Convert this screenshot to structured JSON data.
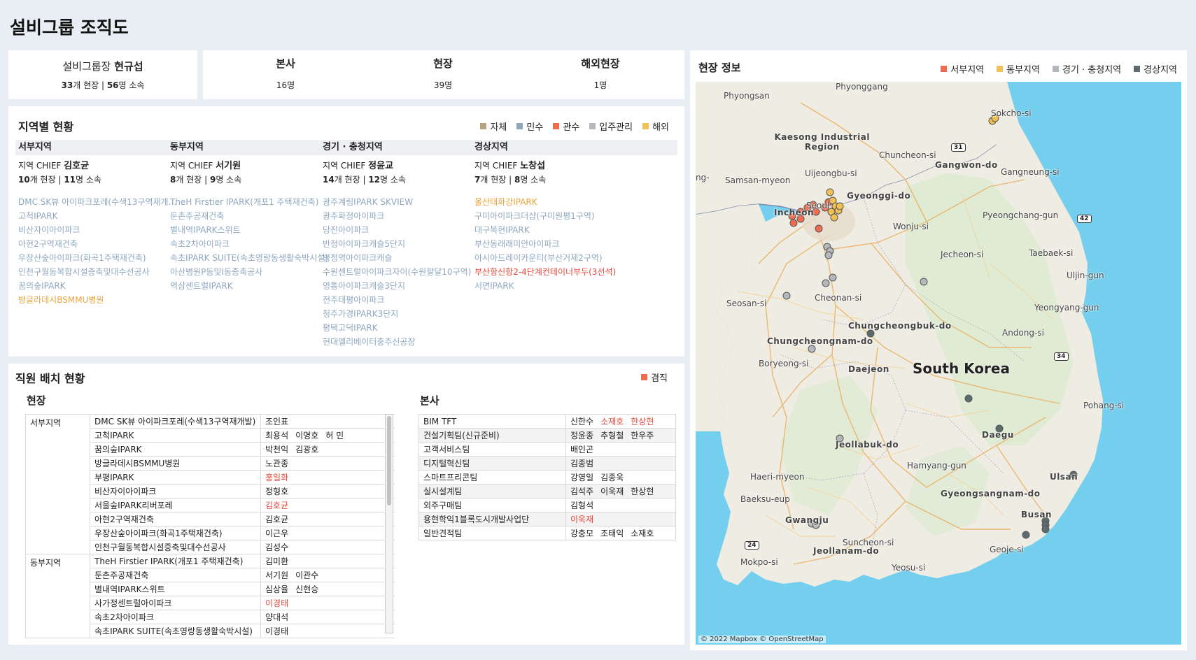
{
  "title": "설비그룹 조직도",
  "leader": {
    "role": "설비그룹장",
    "name": "현규섭",
    "sites": "33",
    "sites_suffix": "개 현장 | ",
    "members": "56",
    "members_suffix": "명 소속"
  },
  "stats": [
    {
      "label": "본사",
      "value": "16명"
    },
    {
      "label": "현장",
      "value": "39명"
    },
    {
      "label": "해외현장",
      "value": "1명"
    }
  ],
  "regional": {
    "title": "지역별 현황",
    "legend": [
      {
        "label": "자체",
        "color": "#b9a27f"
      },
      {
        "label": "민수",
        "color": "#8fa7b8"
      },
      {
        "label": "관수",
        "color": "#f26b50"
      },
      {
        "label": "입주관리",
        "color": "#b4b8bd"
      },
      {
        "label": "해외",
        "color": "#f0c255"
      }
    ],
    "regions": [
      {
        "name": "서부지역",
        "chief_prefix": "지역 CHIEF",
        "chief": "김호균",
        "sites": "10",
        "members": "11",
        "sites_suffix": "개 현장 | ",
        "members_suffix": "명 소속",
        "list": [
          {
            "name": "DMC SK뷰 아이파크포레(수색13구역재개발)",
            "tone": "blue"
          },
          {
            "name": "고척IPARK",
            "tone": "blue"
          },
          {
            "name": "비산자이아이파크",
            "tone": "blue"
          },
          {
            "name": "아현2구역재건축",
            "tone": "blue"
          },
          {
            "name": "우장산숲아이파크(화곡1주택재건축)",
            "tone": "blue"
          },
          {
            "name": "인천구월동복합시설증축및대수선공사",
            "tone": "blue"
          },
          {
            "name": "꿈의숲IPARK",
            "tone": "blue"
          },
          {
            "name": "방글라데시BSMMU병원",
            "tone": "orange"
          }
        ]
      },
      {
        "name": "동부지역",
        "chief_prefix": "지역 CHIEF",
        "chief": "서기원",
        "sites": "8",
        "members": "9",
        "sites_suffix": "개 현장 | ",
        "members_suffix": "명 소속",
        "list": [
          {
            "name": "TheH Firstier IPARK(개포1 주택재건축)",
            "tone": "blue"
          },
          {
            "name": "둔촌주공재건축",
            "tone": "blue"
          },
          {
            "name": "별내역IPARK스위트",
            "tone": "blue"
          },
          {
            "name": "속초2차아이파크",
            "tone": "blue"
          },
          {
            "name": "속초IPARK SUITE(속초영랑동생활숙박시설)",
            "tone": "blue"
          },
          {
            "name": "아산병원P동및I동증축공사",
            "tone": "blue"
          },
          {
            "name": "역삼센트럴IPARK",
            "tone": "blue"
          }
        ]
      },
      {
        "name": "경기 · 충청지역",
        "chief_prefix": "지역 CHIEF",
        "chief": "정윤교",
        "sites": "14",
        "members": "12",
        "sites_suffix": "개 현장 | ",
        "members_suffix": "명 소속",
        "list": [
          {
            "name": "광주계림IPARK SKVIEW",
            "tone": "blue"
          },
          {
            "name": "광주화정아이파크",
            "tone": "blue"
          },
          {
            "name": "당진아이파크",
            "tone": "blue"
          },
          {
            "name": "반정아이파크캐슬5단지",
            "tone": "blue"
          },
          {
            "name": "병점역아이파크캐슬",
            "tone": "blue"
          },
          {
            "name": "수원센트럴아이파크자이(수원팔달10구역)",
            "tone": "blue"
          },
          {
            "name": "영통아이파크캐슬3단지",
            "tone": "blue"
          },
          {
            "name": "전주태평아이파크",
            "tone": "blue"
          },
          {
            "name": "청주가경IPARK3단지",
            "tone": "blue"
          },
          {
            "name": "평택고덕IPARK",
            "tone": "blue"
          },
          {
            "name": "현대엘리베이터충주신공장",
            "tone": "blue"
          }
        ]
      },
      {
        "name": "경상지역",
        "chief_prefix": "지역 CHIEF",
        "chief": "노창섭",
        "sites": "7",
        "members": "8",
        "sites_suffix": "개 현장 | ",
        "members_suffix": "명 소속",
        "list": [
          {
            "name": "울산태화강IPARK",
            "tone": "orange"
          },
          {
            "name": "구미아이파크더샵(구미원평1구역)",
            "tone": "blue"
          },
          {
            "name": "대구복현IPARK",
            "tone": "blue"
          },
          {
            "name": "부산동래래미안아이파크",
            "tone": "blue"
          },
          {
            "name": "아시아드레이카운티(부산거제2구역)",
            "tone": "blue"
          },
          {
            "name": "부산항신항2-4단계컨테이너부두(3선석)",
            "tone": "red"
          },
          {
            "name": "서면IPARK",
            "tone": "blue"
          }
        ]
      }
    ]
  },
  "staffing": {
    "title": "직원 배치 현황",
    "legend_label": "겸직",
    "legend_color": "#f26b50",
    "site_title": "현장",
    "hq_title": "본사",
    "site_rows": [
      {
        "region": "서부지역",
        "site": "DMC SK뷰 아이파크포레(수색13구역재개발)",
        "names": [
          {
            "n": "조인표"
          }
        ]
      },
      {
        "region": "",
        "site": "고척IPARK",
        "names": [
          {
            "n": "최용석"
          },
          {
            "n": "이명호"
          },
          {
            "n": "허 민"
          }
        ]
      },
      {
        "region": "",
        "site": "꿈의숲IPARK",
        "names": [
          {
            "n": "박천익"
          },
          {
            "n": "김광호"
          }
        ]
      },
      {
        "region": "",
        "site": "방글라데시BSMMU병원",
        "names": [
          {
            "n": "노관종"
          }
        ]
      },
      {
        "region": "",
        "site": "부평IPARK",
        "names": [
          {
            "n": "홍일화",
            "red": true
          }
        ]
      },
      {
        "region": "",
        "site": "비산자이아이파크",
        "names": [
          {
            "n": "정형호"
          }
        ]
      },
      {
        "region": "",
        "site": "서울숲IPARK리버포레",
        "names": [
          {
            "n": "김호균",
            "red": true
          }
        ]
      },
      {
        "region": "",
        "site": "아현2구역재건축",
        "names": [
          {
            "n": "김호균"
          }
        ]
      },
      {
        "region": "",
        "site": "우장산숲아이파크(화곡1주택재건축)",
        "names": [
          {
            "n": "이근우"
          }
        ]
      },
      {
        "region": "",
        "site": "인천구월동복합시설증축및대수선공사",
        "names": [
          {
            "n": "김성수"
          }
        ]
      },
      {
        "region": "동부지역",
        "site": "TheH Firstier IPARK(개포1 주택재건축)",
        "names": [
          {
            "n": "김미환"
          }
        ]
      },
      {
        "region": "",
        "site": "둔촌주공재건축",
        "names": [
          {
            "n": "서기원"
          },
          {
            "n": "이관수"
          }
        ]
      },
      {
        "region": "",
        "site": "별내역IPARK스위트",
        "names": [
          {
            "n": "심상율"
          },
          {
            "n": "신현승"
          }
        ]
      },
      {
        "region": "",
        "site": "사가정센트럴아이파크",
        "names": [
          {
            "n": "이경태",
            "red": true
          }
        ]
      },
      {
        "region": "",
        "site": "속초2차아이파크",
        "names": [
          {
            "n": "양대석"
          }
        ]
      },
      {
        "region": "",
        "site": "속초IPARK SUITE(속초영랑동생활숙박시설)",
        "names": [
          {
            "n": "이경태"
          }
        ]
      }
    ],
    "hq_rows": [
      {
        "team": "BIM TFT",
        "names": [
          {
            "n": "신한수"
          },
          {
            "n": "소재호",
            "red": true
          },
          {
            "n": "한상현",
            "red": true
          }
        ]
      },
      {
        "team": "건설기획팀(신규준비)",
        "names": [
          {
            "n": "정윤종"
          },
          {
            "n": "추형철"
          },
          {
            "n": "한우주"
          }
        ]
      },
      {
        "team": "고객서비스팀",
        "names": [
          {
            "n": "배인곤"
          }
        ]
      },
      {
        "team": "디지털혁신팀",
        "names": [
          {
            "n": "김종범"
          }
        ]
      },
      {
        "team": "스마트프리콘팀",
        "names": [
          {
            "n": "강영일"
          },
          {
            "n": "김종욱"
          }
        ]
      },
      {
        "team": "실시설계팀",
        "names": [
          {
            "n": "김석주"
          },
          {
            "n": "이욱재"
          },
          {
            "n": "한상현"
          }
        ]
      },
      {
        "team": "외주구매팀",
        "names": [
          {
            "n": "김형석"
          }
        ]
      },
      {
        "team": "용현학익1블록도시개발사업단",
        "names": [
          {
            "n": "이욱재",
            "red": true
          }
        ]
      },
      {
        "team": "일반견적팀",
        "names": [
          {
            "n": "강충모"
          },
          {
            "n": "조태익"
          },
          {
            "n": "소재호"
          }
        ]
      }
    ]
  },
  "map": {
    "title": "현장 정보",
    "legend": [
      {
        "label": "서부지역",
        "color": "#f26b50"
      },
      {
        "label": "동부지역",
        "color": "#f0c255"
      },
      {
        "label": "경기 · 충청지역",
        "color": "#b4b8bd"
      },
      {
        "label": "경상지역",
        "color": "#5b6b6e"
      }
    ],
    "country": "South Korea",
    "attribution": "© 2022 Mapbox © OpenStreetMap",
    "road_shields": [
      "31",
      "42",
      "34",
      "24"
    ],
    "labels": [
      "Phyongsan",
      "Phyonggang",
      "Sokcho-si",
      "Kaesong Industrial Region",
      "Chuncheon-si",
      "Gangwon-do",
      "Gangneung-si",
      "Uijeongbu-si",
      "Samsan-myeon",
      "ng-",
      "Gyeonggi-do",
      "Incheon",
      "Seoul",
      "Pyeongchang-gun",
      "Wonju-si",
      "Jecheon-si",
      "Taebaek-si",
      "Uljin-gun",
      "Seosan-si",
      "Cheonan-si",
      "Yeongyang-gun",
      "Chungcheongbuk-do",
      "Andong-si",
      "Chungcheongnam-do",
      "Boryeong-si",
      "Daejeon",
      "Pohang-si",
      "Daegu",
      "Jeollabuk-do",
      "Hamyang-gun",
      "Haeri-myeon",
      "Ulsan",
      "Baeksu-eup",
      "Gyeongsangnam-do",
      "Gwangju",
      "Busan",
      "Suncheon-si",
      "Jeollanam-do",
      "Geoje-si",
      "Mokpo-si",
      "Yeosu-si"
    ]
  }
}
